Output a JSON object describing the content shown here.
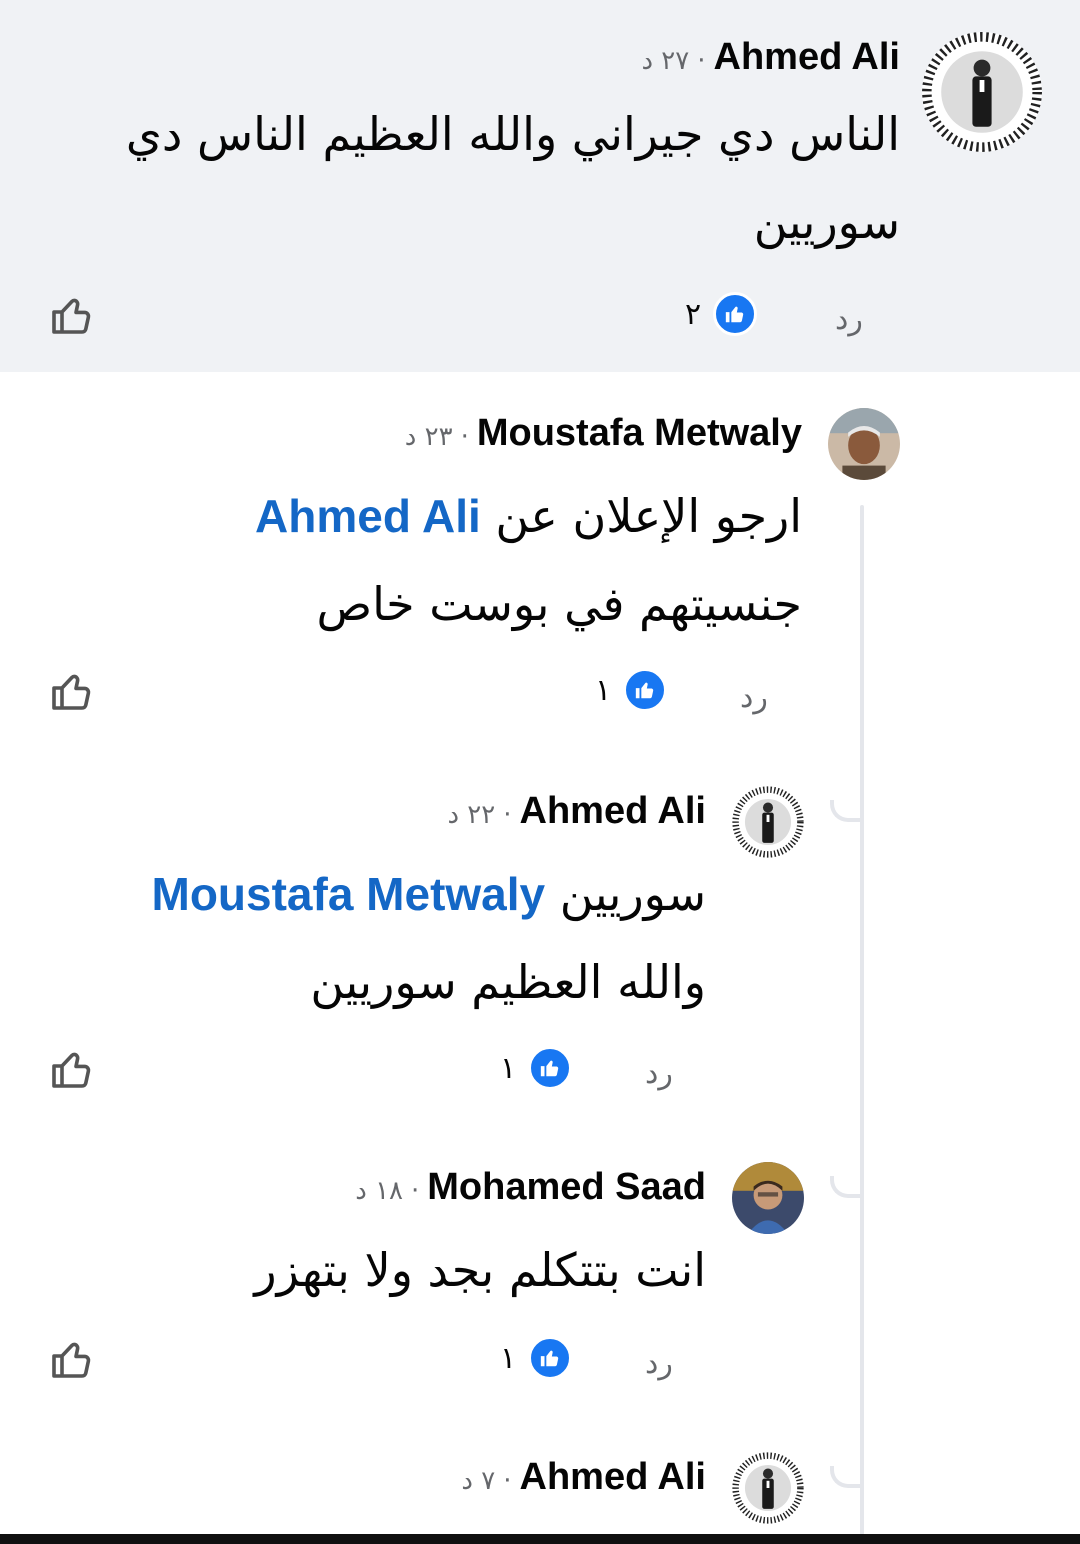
{
  "comments": [
    {
      "author": "Ahmed Ali",
      "separator": "·",
      "time": "٢٧ د",
      "text": "الناس دي جيراني والله العظيم الناس دي سوريين",
      "reply": "رد",
      "reactions": "٢",
      "highlighted": true
    },
    {
      "author": "Moustafa Metwaly",
      "separator": "·",
      "time": "٢٣ د",
      "text_before": "ارجو الإعلان عن",
      "mention": "Ahmed Ali",
      "text_after": "جنسيتهم في بوست خاص",
      "reply": "رد",
      "reactions": "١"
    },
    {
      "author": "Ahmed Ali",
      "separator": "·",
      "time": "٢٢ د",
      "text_before": "سوريين",
      "mention": "Moustafa Metwaly",
      "text_after": "والله العظيم سوريين",
      "reply": "رد",
      "reactions": "١"
    },
    {
      "author": "Mohamed Saad",
      "separator": "·",
      "time": "١٨ د",
      "text": "انت بتتكلم بجد ولا بتهزر",
      "reply": "رد",
      "reactions": "١"
    },
    {
      "author": "Ahmed Ali",
      "separator": "·",
      "time": "٧ د"
    }
  ],
  "icons": {
    "like": "thumbs-up-outline-icon",
    "reaction": "like-reaction-icon"
  },
  "colors": {
    "highlight_bg": "#f0f2f5",
    "mention": "#1467c6",
    "reaction_blue": "#1877f2",
    "meta_gray": "#65676b"
  }
}
